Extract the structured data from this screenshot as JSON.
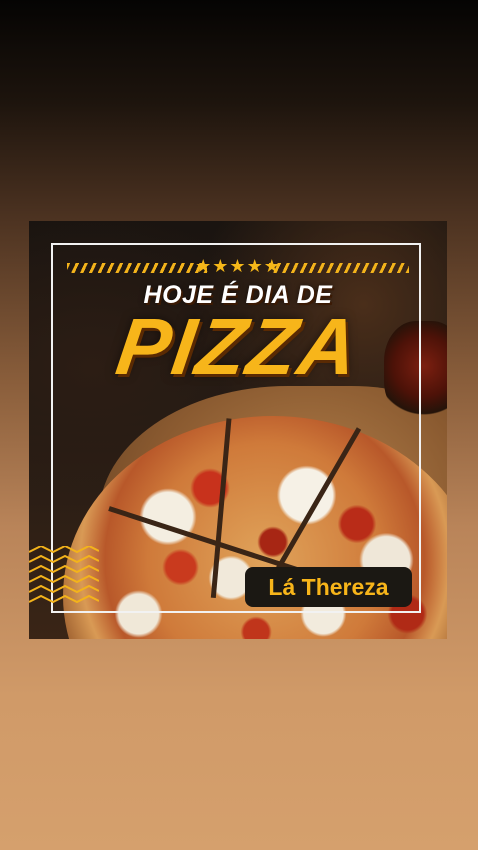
{
  "post": {
    "stars": "★★★★★",
    "subtitle": "HOJE É DIA DE",
    "title": "PIZZA",
    "brand": "Lá Thereza"
  },
  "colors": {
    "accent": "#f7b51a",
    "frame": "#f2f2f2",
    "badge_background": "#1b1813",
    "text": "#ffffff"
  },
  "icons": {
    "stars": "star-rating-icon",
    "decoration": "chevron-pattern-icon"
  }
}
